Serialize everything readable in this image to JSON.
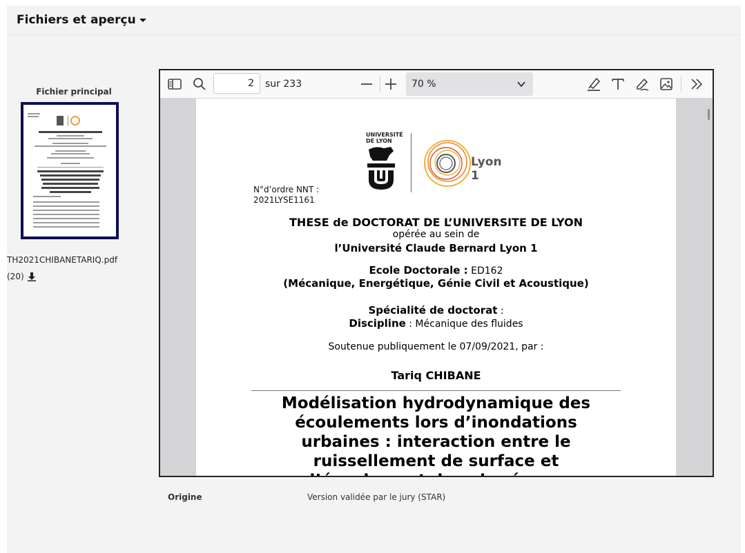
{
  "panel": {
    "title": "Fichiers et aperçu"
  },
  "file": {
    "label": "Fichier principal",
    "name": "TH2021CHIBANETARIQ.pdf",
    "downloads": "(20)",
    "download_icon": "download-icon"
  },
  "viewer": {
    "toolbar": {
      "sidebar_icon": "sidebar-toggle-icon",
      "search_icon": "search-icon",
      "page_number": "2",
      "page_total": "sur 233",
      "zoom_out_icon": "minus-icon",
      "zoom_in_icon": "plus-icon",
      "zoom": "70 %",
      "highlight_icon": "highlight-icon",
      "text_icon": "text-icon",
      "draw_icon": "draw-icon",
      "image_icon": "image-icon",
      "more_icon": "double-chevron-right-icon"
    },
    "page": {
      "logo_udl": "UNIVERSITÉ\nDE LYON",
      "logo_lyon1": "Lyon 1",
      "nnt_label": "N°d’ordre NNT :",
      "nnt_value": "2021LYSE1161",
      "title": "THESE de DOCTORAT DE L’UNIVERSITE DE LYON",
      "operee": "opérée au sein de",
      "university": "l’Université Claude Bernard Lyon 1",
      "ecole_label": "Ecole Doctorale :",
      "ecole_value": " ED162",
      "ecole_name": "(Mécanique, Energétique, Génie Civil et Acoustique)",
      "specialite_label": "Spécialité de doctorat",
      "specialite_value": " :",
      "discipline_label": "Discipline",
      "discipline_value": " : Mécanique des fluides",
      "soutenue": "Soutenue publiquement le 07/09/2021, par :",
      "author": "Tariq CHIBANE",
      "thesis_title_lines": [
        "Modélisation hydrodynamique des",
        "écoulements lors d’inondations",
        "urbaines : interaction entre le",
        "ruissellement de surface et",
        "l’écoulement dans le réseau"
      ]
    }
  },
  "origin": {
    "label": "Origine",
    "value": "Version validée par le jury (STAR)"
  }
}
